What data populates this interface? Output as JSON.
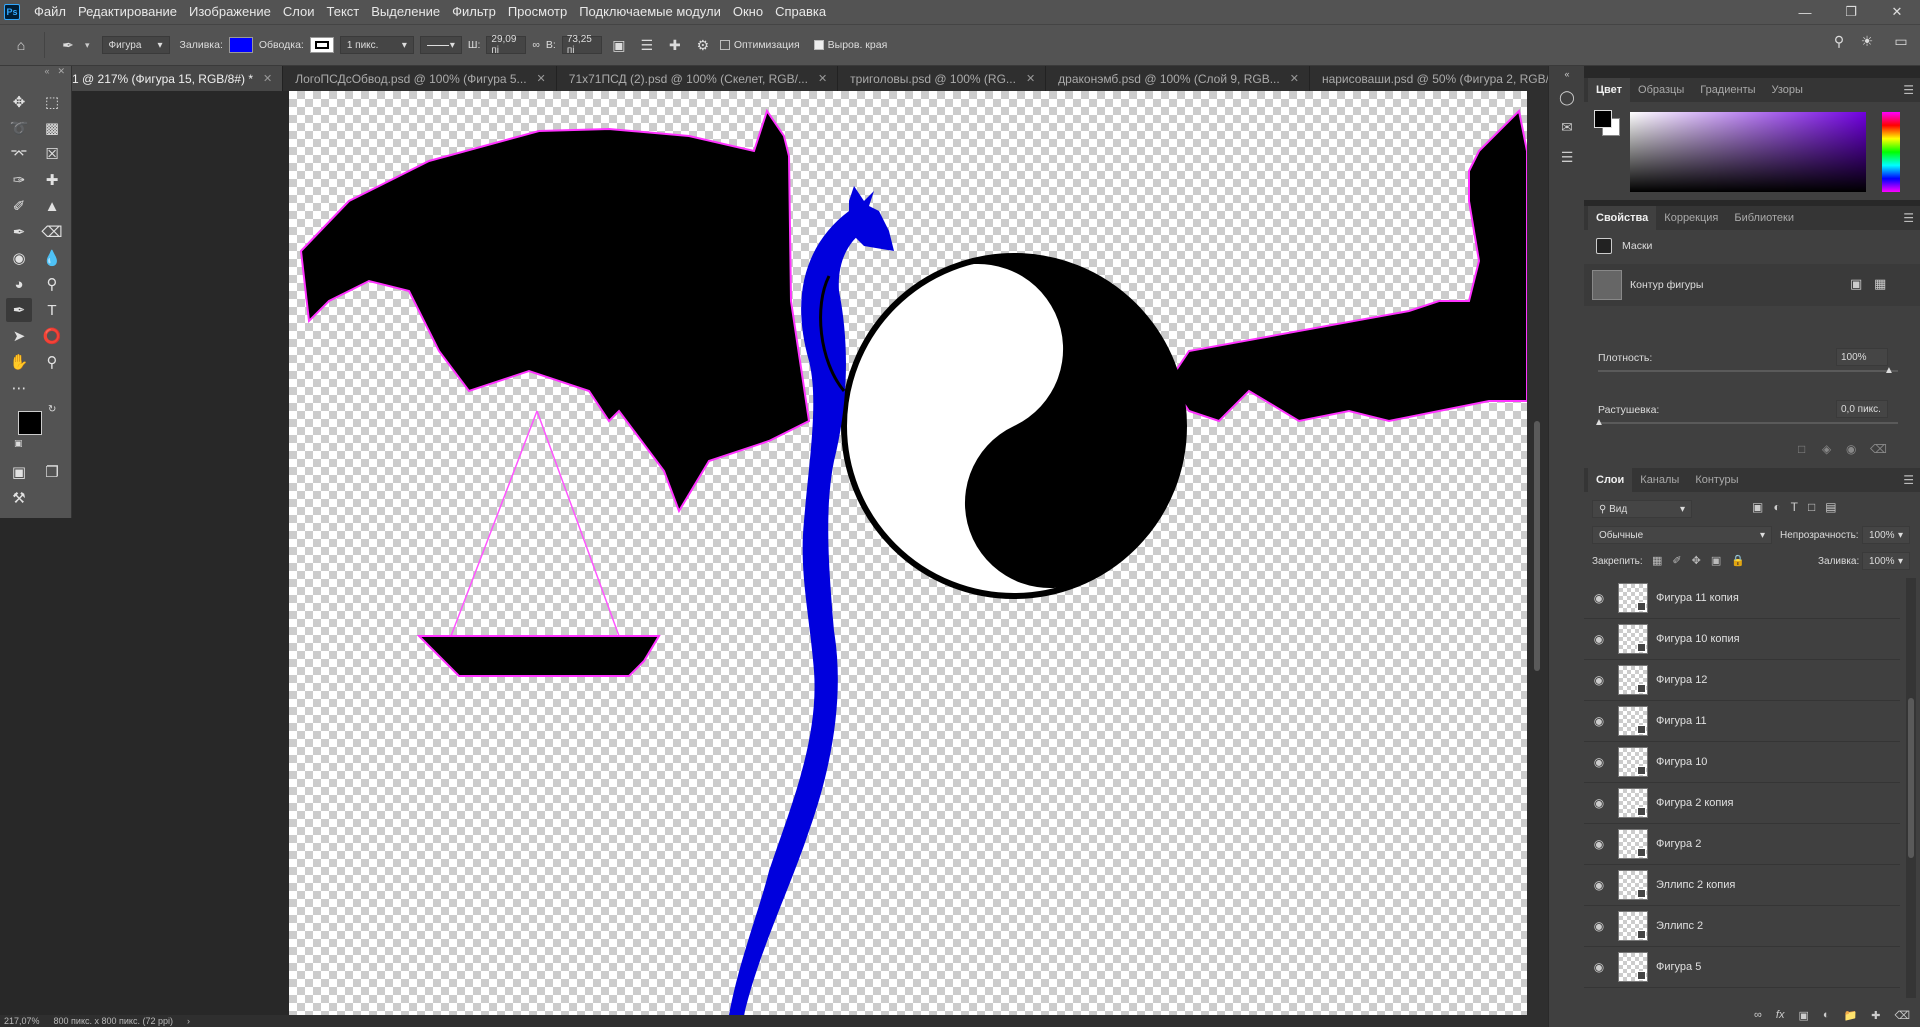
{
  "app": {
    "logo": "Ps"
  },
  "menu": [
    "Файл",
    "Редактирование",
    "Изображение",
    "Слои",
    "Текст",
    "Выделение",
    "Фильтр",
    "Просмотр",
    "Подключаемые модули",
    "Окно",
    "Справка"
  ],
  "options_bar": {
    "tool_mode": "Фигура",
    "fill_label": "Заливка:",
    "fill_color": "#0000ff",
    "stroke_label": "Обводка:",
    "stroke_width": "1 пикс.",
    "w_label": "Ш:",
    "w_value": "29,09 пі",
    "h_label": "В:",
    "h_value": "73,25 пі",
    "optimize_label": "Оптимизация",
    "align_edges_label": "Выров. края"
  },
  "tabs": [
    {
      "label": "1 @ 217% (Фигура 15, RGB/8#) *",
      "active": true
    },
    {
      "label": "ЛогоПСДсОбвод.psd @ 100% (Фигура 5...",
      "active": false
    },
    {
      "label": "71х71ПСД (2).psd @ 100% (Скелет, RGB/...",
      "active": false
    },
    {
      "label": "триголовы.psd @ 100% (RG...",
      "active": false
    },
    {
      "label": "драконэмб.psd @ 100% (Слой 9, RGB...",
      "active": false
    },
    {
      "label": "нарисоваши.psd @ 50% (Фигура 2, RGB/...",
      "active": false
    }
  ],
  "status": {
    "zoom": "217,07%",
    "doc_size": "800 пикс. x 800 пикс. (72 ppi)"
  },
  "color_panel": {
    "tabs": [
      "Цвет",
      "Образцы",
      "Градиенты",
      "Узоры"
    ],
    "foreground": "#000000",
    "background": "#ffffff"
  },
  "properties_panel": {
    "tabs": [
      "Свойства",
      "Коррекция",
      "Библиотеки"
    ],
    "masks_label": "Маски",
    "shape_path_label": "Контур фигуры",
    "density_label": "Плотность:",
    "density_value": "100%",
    "feather_label": "Растушевка:",
    "feather_value": "0,0 пикс."
  },
  "layers_panel": {
    "tabs": [
      "Слои",
      "Каналы",
      "Контуры"
    ],
    "filter_placeholder": "Вид",
    "blend_mode": "Обычные",
    "opacity_label": "Непрозрачность:",
    "opacity_value": "100%",
    "lock_label": "Закрепить:",
    "fill_label": "Заливка:",
    "fill_value": "100%",
    "layers": [
      "Фигура 11 копия",
      "Фигура 10 копия",
      "Фигура 12",
      "Фигура 11",
      "Фигура 10",
      "Фигура 2 копия",
      "Фигура 2",
      "Эллипс 2 копия",
      "Эллипс 2",
      "Фигура 5"
    ]
  }
}
